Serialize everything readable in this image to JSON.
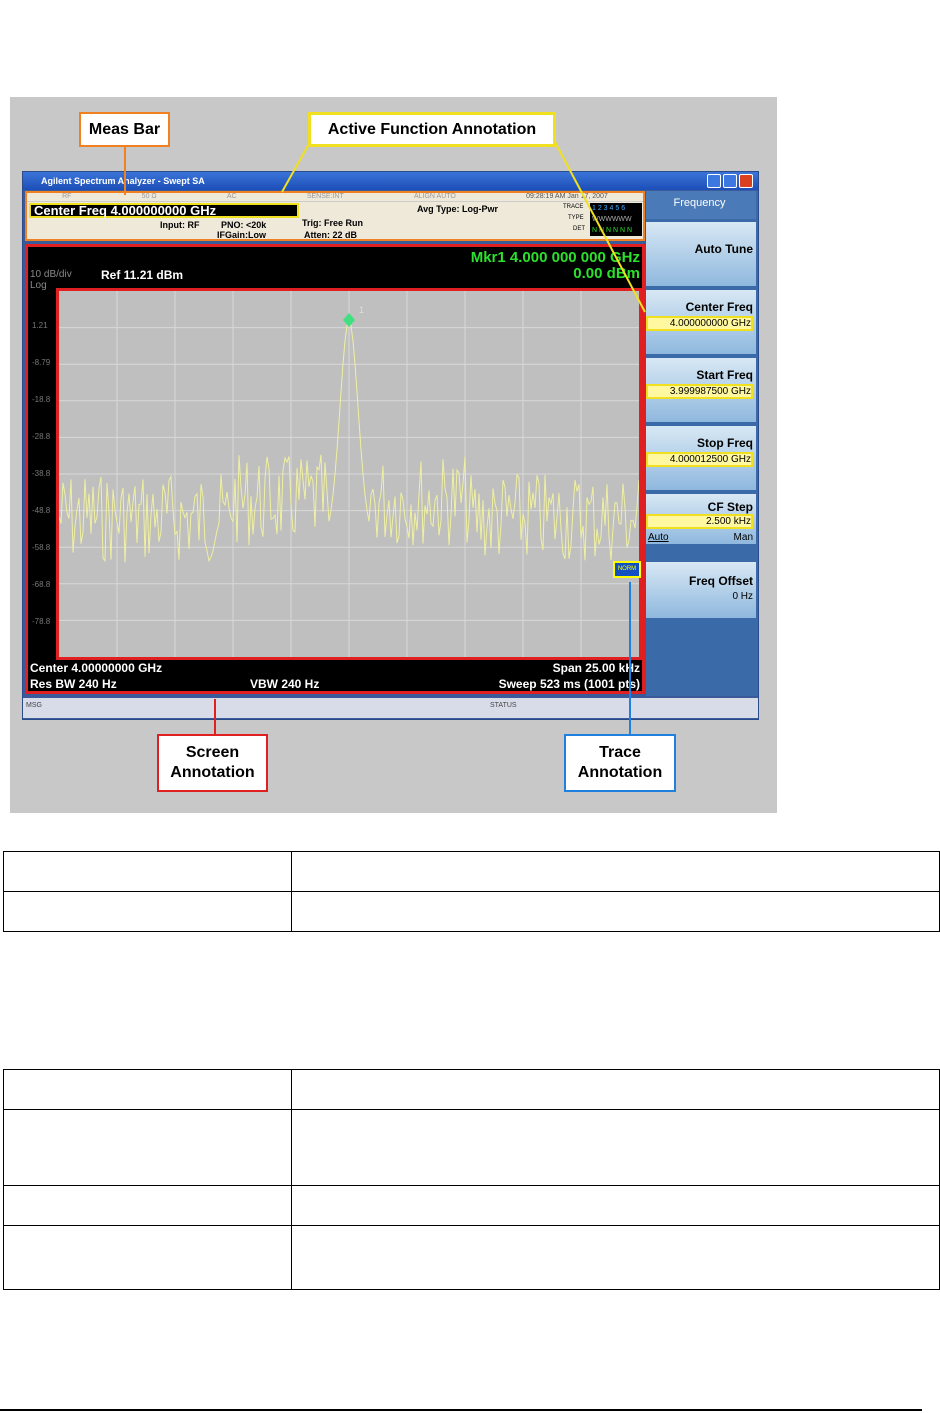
{
  "figure": {
    "callouts": {
      "meas_bar": "Meas Bar",
      "active_function": "Active Function Annotation",
      "screen": "Screen Annotation",
      "trace": "Trace Annotation"
    },
    "window": {
      "title": "Agilent Spectrum Analyzer - Swept SA"
    },
    "meas_bar": {
      "status_row": [
        "RF",
        "50 Ω",
        "AC",
        "SENSE:INT",
        "ALIGN AUTO",
        "09:28:19 AM Jan 17, 2007"
      ],
      "active_function": "Center Freq  4.000000000 GHz",
      "input": "Input: RF",
      "pno": "PNO: <20k",
      "ifgain": "IFGain:Low",
      "trig": "Trig: Free Run",
      "atten": "Atten: 22 dB",
      "avg_type": "Avg Type: Log-Pwr",
      "trace_label": "TRACE",
      "trace_nums": "1 2 3 4 5 6",
      "type_label": "TYPE",
      "det_label": "DET",
      "det_vals": "N N N N N N"
    },
    "graph": {
      "scale": "10 dB/div",
      "ref": "Ref 11.21 dBm",
      "log": "Log",
      "marker_freq": "Mkr1 4.000 000 000 GHz",
      "marker_amp": "0.00 dBm",
      "marker_label": "1",
      "y_ticks": [
        "1.21",
        "-8.79",
        "-18.8",
        "-28.8",
        "-38.8",
        "-48.8",
        "-58.8",
        "-68.8",
        "-78.8"
      ],
      "center": "Center 4.00000000 GHz",
      "span": "Span 25.00 kHz",
      "rbw": "Res BW 240 Hz",
      "vbw": "VBW 240 Hz",
      "sweep": "Sweep  523 ms (1001 pts)",
      "trace_badge": "NORM"
    },
    "softkeys": {
      "menu": "Frequency",
      "auto_tune": "Auto Tune",
      "center_freq": "Center Freq",
      "center_freq_val": "4.000000000 GHz",
      "start_freq": "Start Freq",
      "start_freq_val": "3.999987500 GHz",
      "stop_freq": "Stop Freq",
      "stop_freq_val": "4.000012500 GHz",
      "cf_step": "CF Step",
      "cf_step_val": "2.500 kHz",
      "auto": "Auto",
      "man": "Man",
      "freq_offset": "Freq Offset",
      "freq_offset_val": "0 Hz"
    },
    "status": {
      "msg": "MSG",
      "status": "STATUS"
    },
    "colors": {
      "trace": "#f0f0a0",
      "marker": "#40e080",
      "annotation_red": "#e02020",
      "meas_orange": "#f08020",
      "active_yellow": "#f0e020",
      "trace_blue": "#2080e0"
    }
  }
}
